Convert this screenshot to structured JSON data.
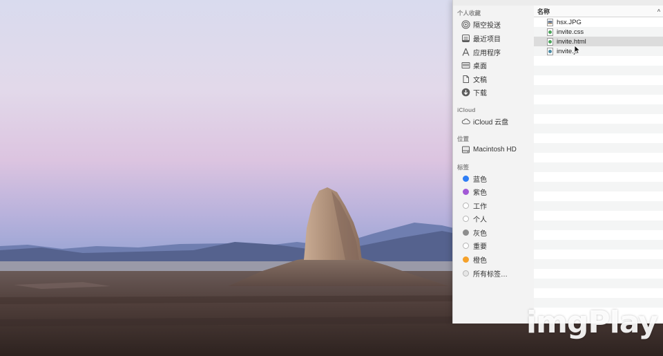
{
  "sidebar": {
    "favorites_heading": "个人收藏",
    "favorites": [
      {
        "label": "隔空投送",
        "icon": "airdrop-icon"
      },
      {
        "label": "最近项目",
        "icon": "recents-icon"
      },
      {
        "label": "应用程序",
        "icon": "applications-icon"
      },
      {
        "label": "桌面",
        "icon": "desktop-icon"
      },
      {
        "label": "文稿",
        "icon": "documents-icon"
      },
      {
        "label": "下载",
        "icon": "downloads-icon"
      }
    ],
    "icloud_heading": "iCloud",
    "icloud": [
      {
        "label": "iCloud 云盘",
        "icon": "cloud-icon"
      }
    ],
    "locations_heading": "位置",
    "locations": [
      {
        "label": "Macintosh HD",
        "icon": "disk-icon"
      }
    ],
    "tags_heading": "标签",
    "tags": [
      {
        "label": "蓝色",
        "color": "#2f7ef5"
      },
      {
        "label": "紫色",
        "color": "#a259d6"
      },
      {
        "label": "工作",
        "color": "#ffffff"
      },
      {
        "label": "个人",
        "color": "#ffffff"
      },
      {
        "label": "灰色",
        "color": "#8e8e8e"
      },
      {
        "label": "重要",
        "color": "#ffffff"
      },
      {
        "label": "橙色",
        "color": "#f5a12a"
      },
      {
        "label": "所有标签…",
        "color": "#e6e6e6"
      }
    ]
  },
  "file_list": {
    "column_name": "名称",
    "sort_indicator": "^",
    "files": [
      {
        "name": "hsx.JPG",
        "icon": "image-file-icon"
      },
      {
        "name": "invite.css",
        "icon": "css-file-icon"
      },
      {
        "name": "invite.html",
        "icon": "html-file-icon",
        "selected": true
      },
      {
        "name": "invite.js",
        "icon": "js-file-icon"
      }
    ]
  },
  "watermark": "imgPlay",
  "colors": {
    "tag_blue": "#2f7ef5",
    "tag_purple": "#a259d6",
    "tag_gray": "#8e8e8e",
    "tag_orange": "#f5a12a",
    "selection": "#dcdcdc"
  }
}
